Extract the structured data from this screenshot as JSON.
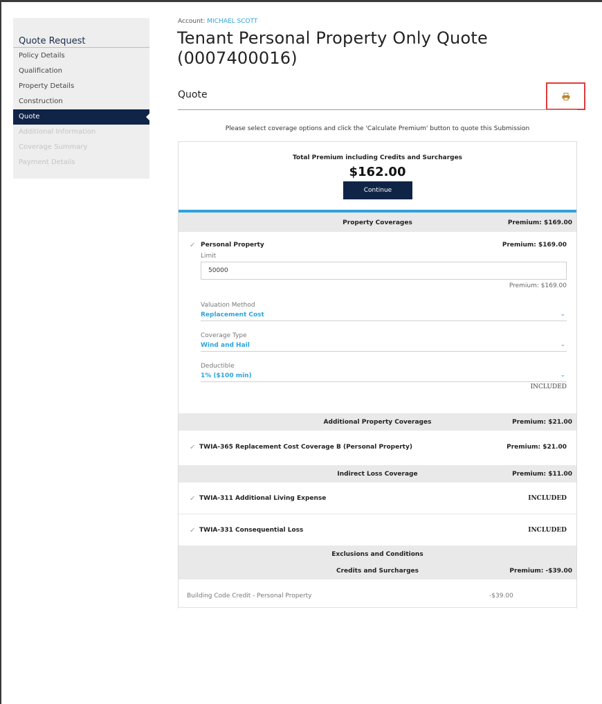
{
  "sidebar": {
    "title": "Quote Request",
    "items": [
      {
        "label": "Policy Details",
        "state": "enabled"
      },
      {
        "label": "Qualification",
        "state": "enabled"
      },
      {
        "label": "Property Details",
        "state": "enabled"
      },
      {
        "label": "Construction",
        "state": "enabled"
      },
      {
        "label": "Quote",
        "state": "active"
      },
      {
        "label": "Additional Information",
        "state": "disabled"
      },
      {
        "label": "Coverage Summary",
        "state": "disabled"
      },
      {
        "label": "Payment Details",
        "state": "disabled"
      }
    ]
  },
  "header": {
    "account_label": "Account:",
    "account_name": "MICHAEL SCOTT",
    "title": "Tenant Personal Property Only Quote (0007400016)"
  },
  "quote": {
    "section_title": "Quote",
    "print_icon": "print-icon",
    "instruction": "Please select coverage options and click the 'Calculate Premium' button to quote this Submission",
    "total_label": "Total Premium including Credits and Surcharges",
    "total_value": "$162.00",
    "continue_label": "Continue"
  },
  "property_coverages": {
    "header": "Property Coverages",
    "premium": "Premium:  $169.00",
    "personal_property": {
      "name": "Personal Property",
      "premium": "Premium:  $169.00",
      "limit_label": "Limit",
      "limit_value": "50000",
      "limit_premium": "Premium:  $169.00",
      "valuation_label": "Valuation Method",
      "valuation_value": "Replacement Cost",
      "coverage_type_label": "Coverage Type",
      "coverage_type_value": "Wind and Hail",
      "deductible_label": "Deductible",
      "deductible_value": "1% ($100 min)",
      "deductible_status": "INCLUDED"
    }
  },
  "additional_coverages": {
    "header": "Additional Property Coverages",
    "premium": "Premium:  $21.00",
    "items": [
      {
        "name": "TWIA-365 Replacement Cost Coverage B (Personal Property)",
        "value": "Premium:  $21.00"
      }
    ]
  },
  "indirect_loss": {
    "header": "Indirect Loss Coverage",
    "premium": "Premium:  $11.00",
    "items": [
      {
        "name": "TWIA-311 Additional Living Expense",
        "value": "INCLUDED"
      },
      {
        "name": "TWIA-331 Consequential Loss",
        "value": "INCLUDED"
      }
    ]
  },
  "exclusions": {
    "header": "Exclusions and Conditions"
  },
  "credits": {
    "header": "Credits and Surcharges",
    "premium": "Premium:  -$39.00",
    "items": [
      {
        "name": "Building Code Credit - Personal Property",
        "amount": "-$39.00"
      }
    ]
  },
  "colors": {
    "navy": "#0f2447",
    "accent_blue": "#2ea3dd",
    "highlight_red": "#e03a3a",
    "band_gray": "#e9e9e9"
  }
}
